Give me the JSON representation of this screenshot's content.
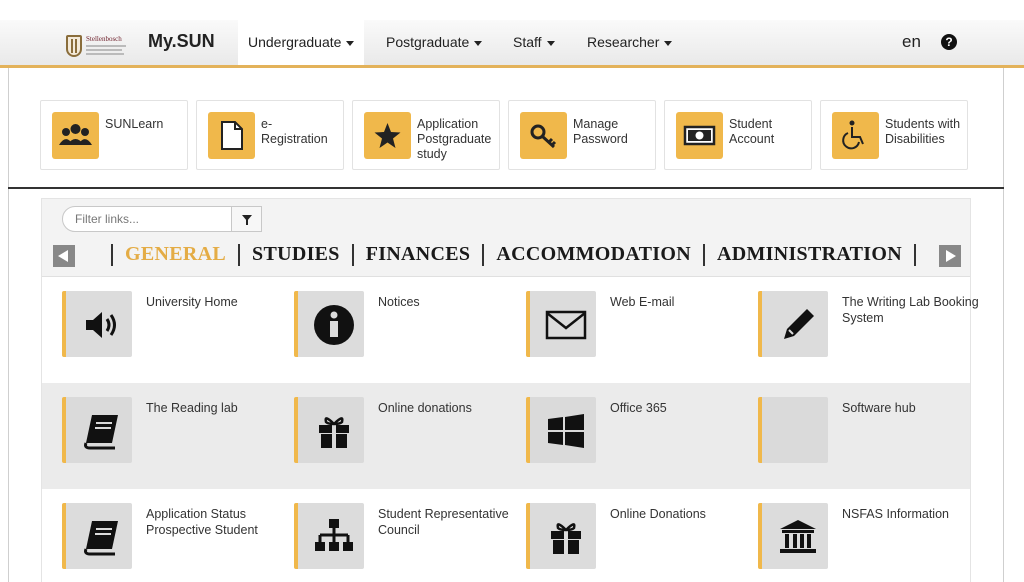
{
  "header": {
    "logo_text": "Stellenbosch",
    "brand": "My.SUN",
    "nav": [
      {
        "label": "Undergraduate"
      },
      {
        "label": "Postgraduate"
      },
      {
        "label": "Staff"
      },
      {
        "label": "Researcher"
      }
    ],
    "language": "en",
    "help_icon": "question-circle-icon"
  },
  "quick_links": [
    {
      "label": "SUNLearn",
      "icon": "users-icon"
    },
    {
      "label": "e-\nRegistration",
      "icon": "document-icon"
    },
    {
      "label": "Application\nPostgraduate\nstudy",
      "icon": "star-icon"
    },
    {
      "label": "Manage\nPassword",
      "icon": "key-icon"
    },
    {
      "label": "Student\nAccount",
      "icon": "money-icon"
    },
    {
      "label": "Students with\nDisabilities",
      "icon": "wheelchair-icon"
    }
  ],
  "browser": {
    "filter_placeholder": "Filter links...",
    "categories": [
      "GENERAL",
      "STUDIES",
      "FINANCES",
      "ACCOMMODATION",
      "ADMINISTRATION"
    ],
    "active_category": "GENERAL",
    "rows": [
      [
        {
          "label": "University Home",
          "icon": "volume-up-icon"
        },
        {
          "label": "Notices",
          "icon": "info-circle-icon"
        },
        {
          "label": "Web E-mail",
          "icon": "envelope-icon"
        },
        {
          "label": "The Writing Lab Booking System",
          "icon": "pencil-icon"
        }
      ],
      [
        {
          "label": "The Reading lab",
          "icon": "book-icon"
        },
        {
          "label": "Online donations",
          "icon": "gift-icon"
        },
        {
          "label": "Office 365",
          "icon": "windows-icon"
        },
        {
          "label": "Software hub",
          "icon": ""
        }
      ],
      [
        {
          "label": "Application Status Prospective Student",
          "icon": "book-icon"
        },
        {
          "label": "Student Representative Council",
          "icon": "sitemap-icon"
        },
        {
          "label": "Online Donations",
          "icon": "gift-icon"
        },
        {
          "label": "NSFAS Information",
          "icon": "bank-icon"
        }
      ]
    ]
  },
  "colors": {
    "accent": "#f0b84b",
    "active_category": "#e4ac45",
    "nav_underline": "#e3b25a"
  }
}
